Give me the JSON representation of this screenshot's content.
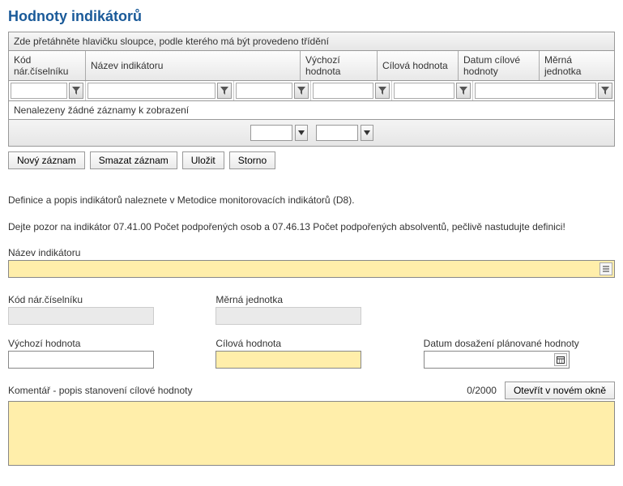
{
  "title": "Hodnoty indikátorů",
  "grid": {
    "group_hint": "Zde přetáhněte hlavičku sloupce, podle kterého má být provedeno třídění",
    "columns": [
      "Kód nár.číselníku",
      "Název indikátoru",
      "Výchozí hodnota",
      "Cílová hodnota",
      "Datum cílové hodnoty",
      "Měrná jednotka"
    ],
    "no_records": "Nenalezeny žádné záznamy k zobrazení"
  },
  "buttons": {
    "new": "Nový záznam",
    "delete": "Smazat záznam",
    "save": "Uložit",
    "cancel": "Storno",
    "open_window": "Otevřít v novém okně"
  },
  "info": {
    "line1": "Definice a popis indikátorů naleznete v Metodice monitorovacích indikátorů (D8).",
    "line2": "Dejte pozor na indikátor 07.41.00 Počet podpořených osob a 07.46.13 Počet podpořených absolventů, pečlivě nastudujte definici!"
  },
  "form": {
    "nazev_label": "Název indikátoru",
    "kod_label": "Kód nár.číselníku",
    "jednotka_label": "Měrná jednotka",
    "vychozi_label": "Výchozí hodnota",
    "cilova_label": "Cílová hodnota",
    "datum_label": "Datum dosažení plánované hodnoty",
    "komentar_label": "Komentář - popis stanovení cílové hodnoty",
    "komentar_counter": "0/2000"
  }
}
